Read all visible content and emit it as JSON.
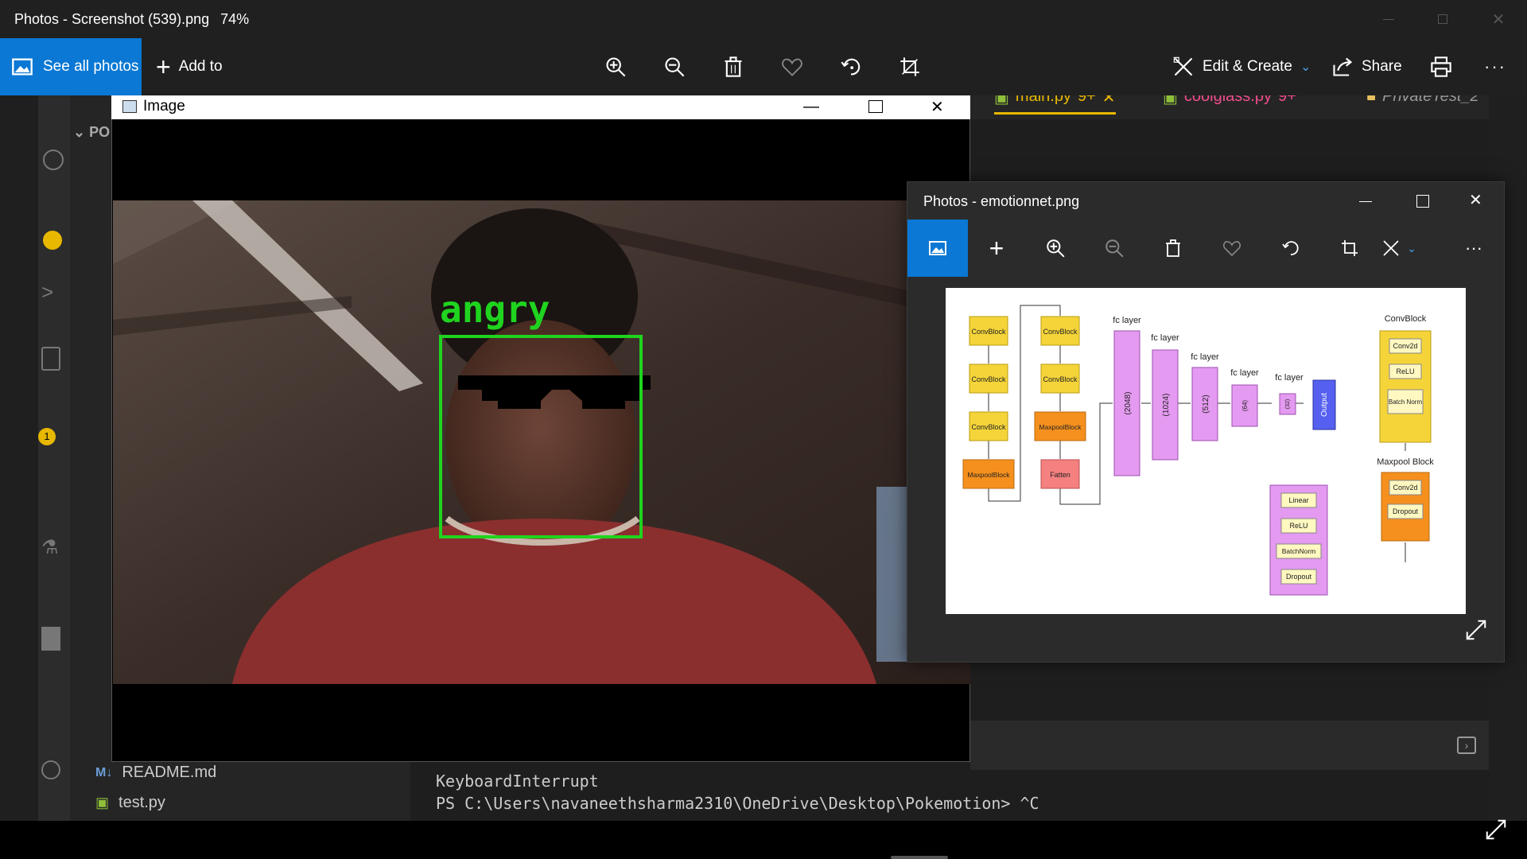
{
  "photos_app": {
    "title": "Photos - Screenshot (539).png",
    "zoom": "74%",
    "see_all_label": "See all photos",
    "add_to_label": "Add to",
    "edit_create_label": "Edit & Create",
    "share_label": "Share",
    "accent": "#0a78d4"
  },
  "vscode": {
    "tabs": [
      {
        "label": "main.py",
        "badge": "9+"
      },
      {
        "label": "coolglass.py",
        "badge": "9+"
      },
      {
        "label": "PrivateTest_2"
      }
    ],
    "explorer_header": "PO",
    "files": [
      "README.md",
      "test.py"
    ],
    "activity_badge": "1",
    "terminal_lines": [
      "KeyboardInterrupt",
      "PS C:\\Users\\navaneethsharma2310\\OneDrive\\Desktop\\Pokemotion> ^C"
    ]
  },
  "image_window": {
    "title": "Image",
    "emotion_label": "angry",
    "box_color": "#1fd41f"
  },
  "emotionnet_window": {
    "title": "Photos - emotionnet.png"
  },
  "diagram": {
    "col1": [
      "ConvBlock",
      "ConvBlock",
      "ConvBlock",
      "MaxpoolBlock"
    ],
    "col2": [
      "ConvBlock",
      "ConvBlock",
      "MaxpoolBlock",
      "Fatten"
    ],
    "fc_layers": [
      {
        "label": "fc layer",
        "size": "(2048)"
      },
      {
        "label": "fc layer",
        "size": "(1024)"
      },
      {
        "label": "fc layer",
        "size": "(512)"
      },
      {
        "label": "fc layer",
        "size": "(64)"
      },
      {
        "label": "fc layer",
        "size": "(32)"
      }
    ],
    "output": "Output",
    "fc_block": [
      "Linear",
      "ReLU",
      "BatchNorm",
      "Dropout"
    ],
    "convblock_title": "ConvBlock",
    "convblock_items": [
      "Conv2d",
      "ReLU",
      "Batch Norm"
    ],
    "maxpool_title": "Maxpool Block",
    "maxpool_items": [
      "Conv2d",
      "Dropout"
    ]
  }
}
